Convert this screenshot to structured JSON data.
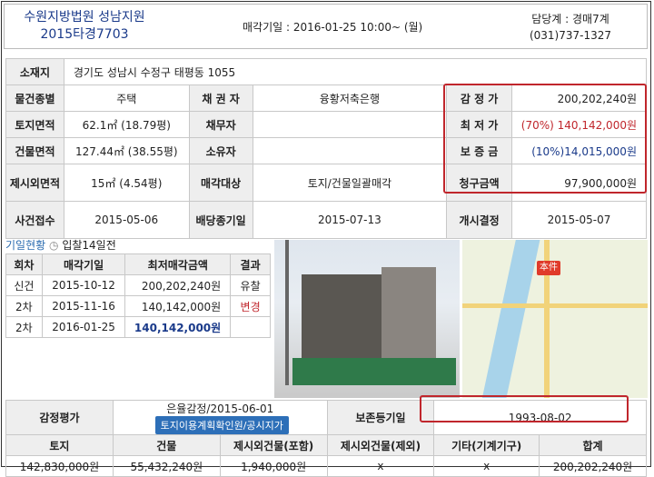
{
  "header": {
    "court": "수원지방법원 성남지원",
    "case_no": "2015타경7703",
    "sale_date": "매각기일 : 2016-01-25   10:00~ (월)",
    "dept": "담당계 : 경매7계",
    "phone": "(031)737-1327"
  },
  "property": {
    "location_label": "소재지",
    "location": "경기도 성남시 수정구 태평동 1055",
    "type_label": "물건종별",
    "type": "주택",
    "creditor_label": "채 권 자",
    "creditor": "융황저축은행",
    "appraisal_label": "감 정 가",
    "appraisal": "200,202,240원",
    "land_area_label": "토지면적",
    "land_area": "62.1㎡ (18.79평)",
    "debtor_label": "채무자",
    "debtor": "",
    "min_price_label": "최 저 가",
    "min_price": "(70%) 140,142,000원",
    "bldg_area_label": "건물면적",
    "bldg_area": "127.44㎡ (38.55평)",
    "owner_label": "소유자",
    "owner": "",
    "deposit_label": "보 증 금",
    "deposit": "(10%)14,015,000원",
    "excluded_label": "제시외면적",
    "excluded": "15㎡ (4.54평)",
    "sale_target_label": "매각대상",
    "sale_target": "토지/건물일괄매각",
    "claim_label": "청구금액",
    "claim": "97,900,000원",
    "case_date_label": "사건접수",
    "case_date": "2015-05-06",
    "dividend_label": "배당종기일",
    "dividend": "2015-07-13",
    "start_label": "개시결정",
    "start": "2015-05-07"
  },
  "status": {
    "title": "기일현황",
    "bid": "입찰14일전"
  },
  "history": {
    "headers": [
      "회차",
      "매각기일",
      "최저매각금액",
      "결과"
    ],
    "rows": [
      [
        "신건",
        "2015-10-12",
        "200,202,240원",
        "유찰"
      ],
      [
        "2차",
        "2015-11-16",
        "140,142,000원",
        "변경"
      ],
      [
        "2차",
        "2016-01-25",
        "140,142,000원",
        ""
      ]
    ]
  },
  "map_pin": "本件",
  "appraisal": {
    "label": "감정평가",
    "value": "은율감정/2015-06-01",
    "button": "토지이용계획확인원/공시지가",
    "reg_label": "보존등기일",
    "reg_date": "1993-08-02",
    "headers": [
      "토지",
      "건물",
      "제시외건물(포함)",
      "제시외건물(제외)",
      "기타(기계기구)",
      "합계"
    ],
    "values": [
      "142,830,000원",
      "55,432,240원",
      "1,940,000원",
      "x",
      "x",
      "200,202,240원"
    ]
  },
  "colors": {
    "accent": "#c0262c",
    "link": "#1a3a8a",
    "button": "#2d6fb8"
  }
}
